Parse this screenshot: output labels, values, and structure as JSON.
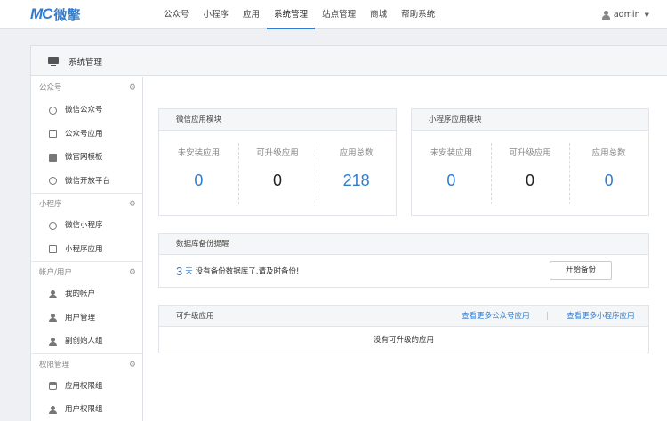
{
  "header": {
    "logo_mark": "MC",
    "logo_text": "微擎",
    "nav": [
      "公众号",
      "小程序",
      "应用",
      "系统管理",
      "站点管理",
      "商城",
      "帮助系统"
    ],
    "active_nav": "系统管理",
    "user": "admin"
  },
  "page": {
    "title": "系统管理"
  },
  "sidebar": {
    "groups": [
      {
        "title": "公众号",
        "items": [
          {
            "label": "微信公众号",
            "icon": "wechat-icon"
          },
          {
            "label": "公众号应用",
            "icon": "app-icon"
          },
          {
            "label": "微官网模板",
            "icon": "template-icon"
          },
          {
            "label": "微信开放平台",
            "icon": "platform-icon"
          }
        ]
      },
      {
        "title": "小程序",
        "items": [
          {
            "label": "微信小程序",
            "icon": "miniprogram-icon"
          },
          {
            "label": "小程序应用",
            "icon": "app-icon"
          }
        ]
      },
      {
        "title": "帐户/用户",
        "items": [
          {
            "label": "我的帐户",
            "icon": "user-icon"
          },
          {
            "label": "用户管理",
            "icon": "users-icon"
          },
          {
            "label": "副创始人组",
            "icon": "group-icon"
          }
        ]
      },
      {
        "title": "权限管理",
        "items": [
          {
            "label": "应用权限组",
            "icon": "lock-icon"
          },
          {
            "label": "用户权限组",
            "icon": "user-icon"
          }
        ]
      }
    ]
  },
  "wechat_module": {
    "title": "微信应用模块",
    "stats": [
      {
        "label": "未安装应用",
        "value": "0",
        "color": "blue"
      },
      {
        "label": "可升级应用",
        "value": "0",
        "color": "dark"
      },
      {
        "label": "应用总数",
        "value": "218",
        "color": "blue"
      }
    ]
  },
  "mini_module": {
    "title": "小程序应用模块",
    "stats": [
      {
        "label": "未安装应用",
        "value": "0",
        "color": "blue"
      },
      {
        "label": "可升级应用",
        "value": "0",
        "color": "dark"
      },
      {
        "label": "应用总数",
        "value": "0",
        "color": "blue"
      }
    ]
  },
  "backup": {
    "title": "数据库备份提醒",
    "days": "3",
    "days_unit": "天",
    "message": "没有备份数据库了,请及时备份!",
    "button": "开始备份"
  },
  "upgrade": {
    "title": "可升级应用",
    "link_wechat": "查看更多公众号应用",
    "separator": "|",
    "link_mini": "查看更多小程序应用",
    "empty": "没有可升级的应用"
  },
  "colors": {
    "accent": "#2f7dd1"
  }
}
